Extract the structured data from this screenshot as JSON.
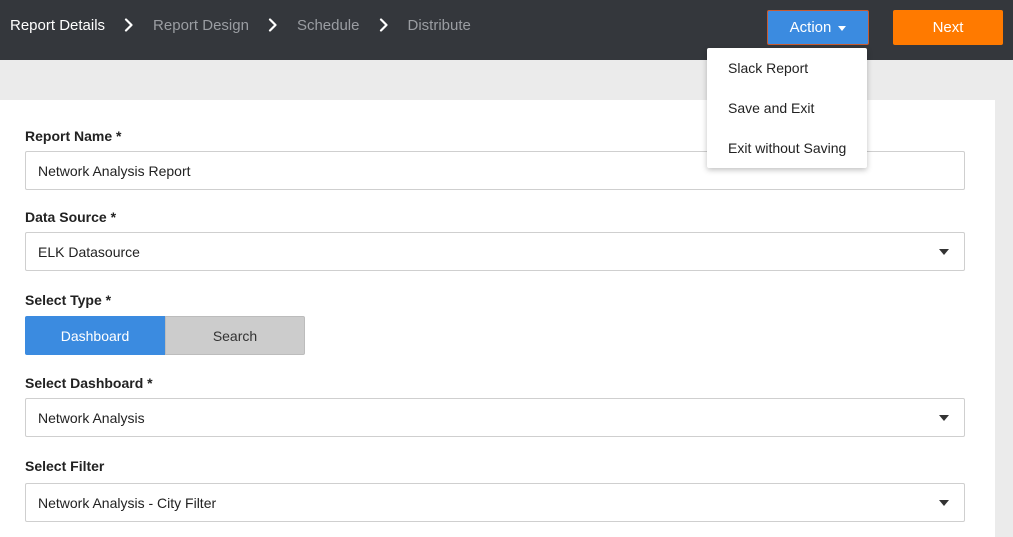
{
  "breadcrumb": {
    "steps": [
      {
        "label": "Report Details"
      },
      {
        "label": "Report Design"
      },
      {
        "label": "Schedule"
      },
      {
        "label": "Distribute"
      }
    ]
  },
  "toolbar": {
    "action_label": "Action",
    "next_label": "Next"
  },
  "action_menu": {
    "items": [
      {
        "label": "Slack Report"
      },
      {
        "label": "Save and Exit"
      },
      {
        "label": "Exit without Saving"
      }
    ]
  },
  "form": {
    "report_name": {
      "label": "Report Name *",
      "value": "Network Analysis Report"
    },
    "data_source": {
      "label": "Data Source *",
      "value": "ELK Datasource"
    },
    "select_type": {
      "label": "Select Type *",
      "options": [
        {
          "label": "Dashboard",
          "selected": true
        },
        {
          "label": "Search",
          "selected": false
        }
      ]
    },
    "select_dashboard": {
      "label": "Select Dashboard *",
      "value": "Network Analysis"
    },
    "select_filter": {
      "label": "Select Filter",
      "value": "Network Analysis - City Filter"
    }
  },
  "colors": {
    "topbar": "#34373c",
    "accent_blue": "#3b8be0",
    "next_orange": "#ff7a00"
  },
  "icons": {
    "breadcrumb_separator": "chevron-right-icon",
    "action_caret": "caret-down-icon",
    "select_caret": "caret-down-icon"
  }
}
